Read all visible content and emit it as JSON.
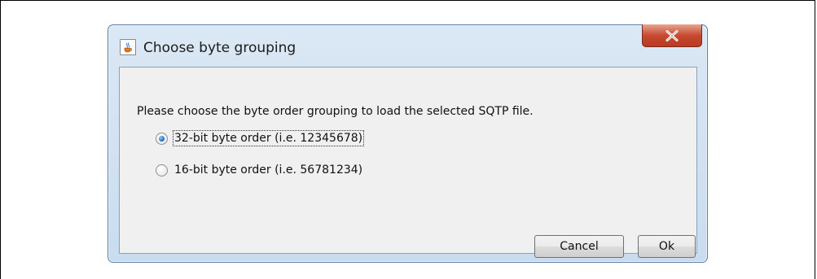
{
  "dialog": {
    "title": "Choose byte grouping",
    "app_icon": "java-cup-icon",
    "close_icon": "close-x-icon",
    "close_button_color": "#c7492f",
    "prompt": "Please choose the byte order grouping to load the selected SQTP file.",
    "options": [
      {
        "label": "32-bit byte order (i.e. 12345678)",
        "selected": true,
        "focused": true
      },
      {
        "label": "16-bit byte order (i.e. 56781234)",
        "selected": false,
        "focused": false
      }
    ],
    "buttons": {
      "cancel": "Cancel",
      "ok": "Ok"
    }
  }
}
